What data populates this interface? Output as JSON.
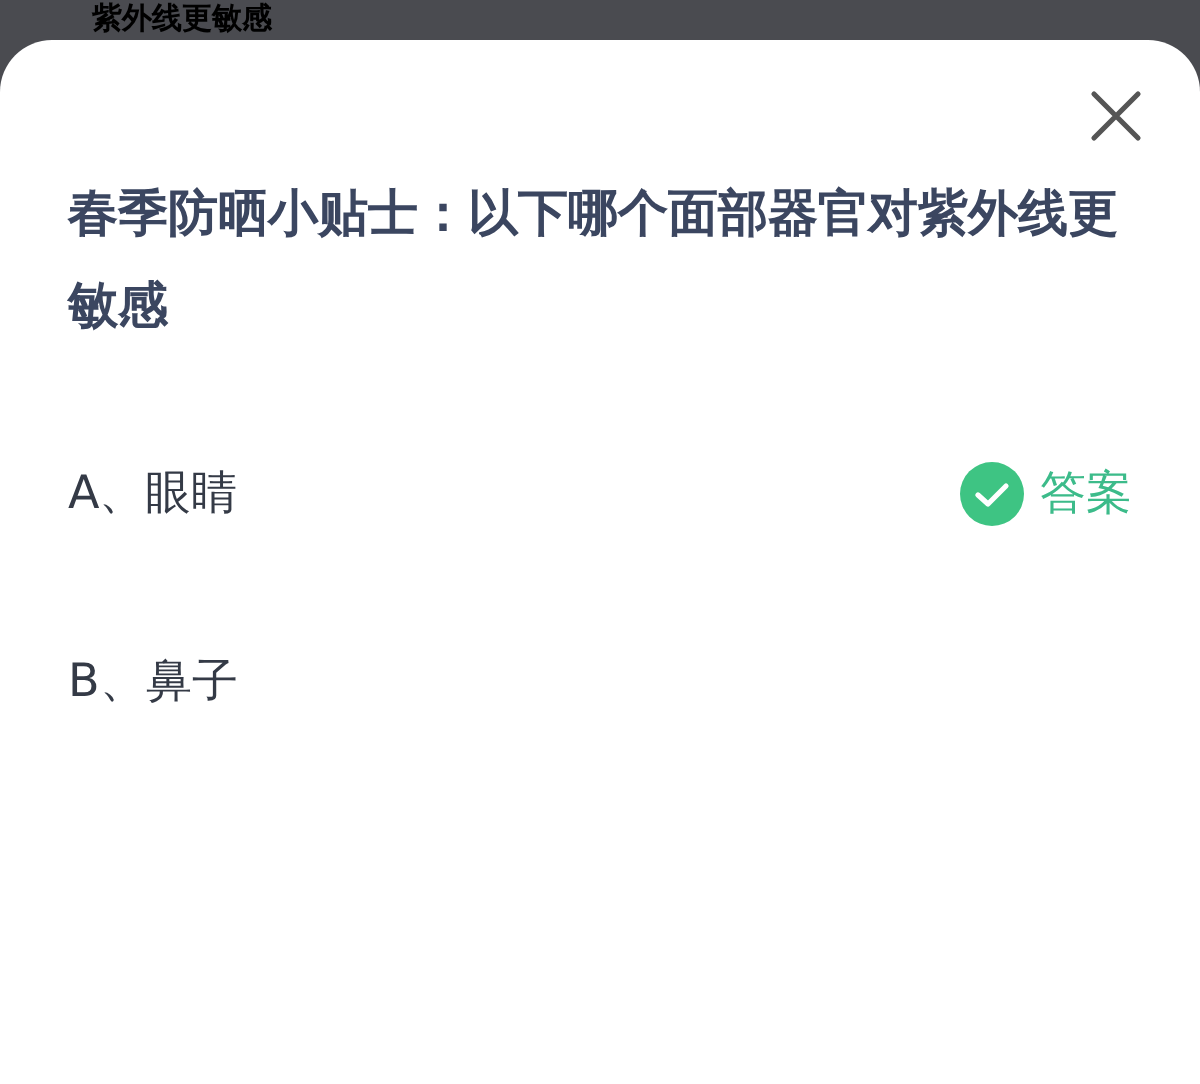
{
  "background_title": "紫外线更敏感",
  "question": "春季防晒小贴士：以下哪个面部器官对紫外线更敏感",
  "options": [
    {
      "label": "A、眼睛",
      "answer": true,
      "answer_text": "答案"
    },
    {
      "label": "B、鼻子",
      "answer": false
    }
  ]
}
